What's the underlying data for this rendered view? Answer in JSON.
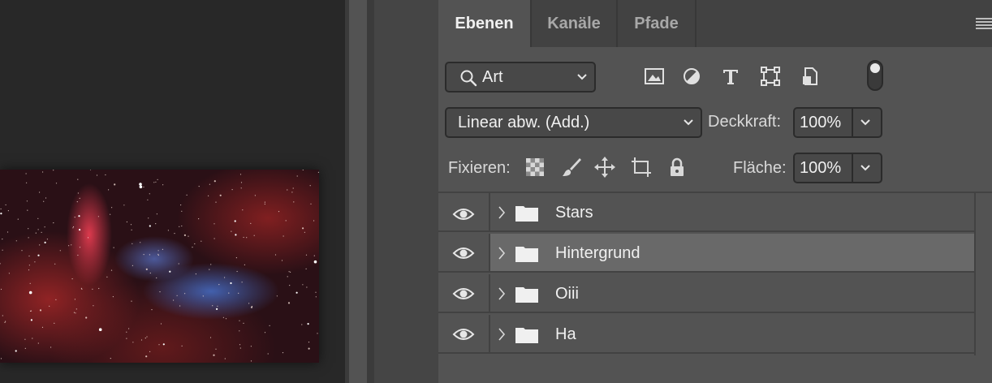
{
  "tabs": [
    {
      "label": "Ebenen",
      "active": true
    },
    {
      "label": "Kanäle",
      "active": false
    },
    {
      "label": "Pfade",
      "active": false
    }
  ],
  "filter": {
    "kind_label": "Art",
    "icons": [
      "image-filter-icon",
      "adjustment-filter-icon",
      "type-filter-icon",
      "shape-filter-icon",
      "smart-object-filter-icon"
    ],
    "toggle_state": "on"
  },
  "blend": {
    "mode": "Linear abw. (Add.)",
    "opacity_label": "Deckkraft:",
    "opacity_value": "100%"
  },
  "lock": {
    "label": "Fixieren:",
    "icons": [
      "lock-transparent-pixels-icon",
      "lock-image-pixels-icon",
      "lock-position-icon",
      "lock-artboard-icon",
      "lock-all-icon"
    ],
    "fill_label": "Fläche:",
    "fill_value": "100%"
  },
  "layers": [
    {
      "name": "Stars",
      "type": "group",
      "visible": true,
      "selected": false
    },
    {
      "name": "Hintergrund",
      "type": "group",
      "visible": true,
      "selected": true
    },
    {
      "name": "Oiii",
      "type": "group",
      "visible": true,
      "selected": false
    },
    {
      "name": "Ha",
      "type": "group",
      "visible": true,
      "selected": false
    }
  ],
  "colors": {
    "panel_bg": "#535353",
    "tab_bar": "#424242",
    "selected_row": "#696969",
    "canvas_bg": "#282828"
  }
}
